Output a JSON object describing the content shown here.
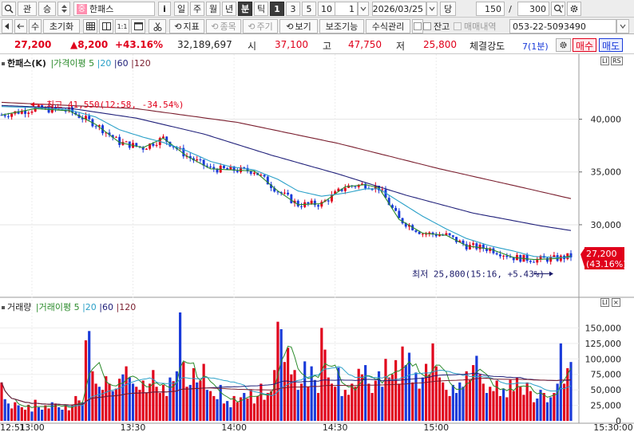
{
  "toolbar1": {
    "kwan": "관",
    "seung": "승",
    "stock_badge": "중",
    "stock_name": "한패스",
    "info_label": "i",
    "periods": [
      "일",
      "주",
      "월",
      "년",
      "분",
      "틱"
    ],
    "active_period": "분",
    "intervals": [
      "1",
      "3",
      "5",
      "10"
    ],
    "active_interval": "1",
    "interval_value": "1",
    "date": "2026/03/25",
    "dang": "당",
    "count_value": "150",
    "slash": "/",
    "total_value": "300"
  },
  "toolbar2": {
    "su": "수",
    "reset": "초기화",
    "indicator": "지표",
    "jongmok": "종목",
    "jugi": "주기",
    "view": "보기",
    "aux": "보조기능",
    "formula": "수식관리",
    "janggo": "잔고",
    "trade_history": "매매내역",
    "account": "053-22-5093490"
  },
  "info": {
    "price": "27,200",
    "change": "▲8,200",
    "change_pct": "+43.16%",
    "volume": "32,189,697",
    "open_label": "시",
    "open": "37,100",
    "high_label": "고",
    "high": "47,750",
    "low_label": "저",
    "low": "25,800",
    "strength_label": "체결강도",
    "strength_value": "7(1분)",
    "buy_label": "매수",
    "sell_label": "매도"
  },
  "legend_price": {
    "name": "한패스(K)",
    "ma_label": "가격이평",
    "periods": [
      "5",
      "20",
      "60",
      "120"
    ]
  },
  "legend_volume": {
    "name": "거래량",
    "ma_label": "거래이평",
    "periods": [
      "5",
      "20",
      "60",
      "120"
    ]
  },
  "annotations": {
    "high": "최고 41,550(12:58, -34.54%)",
    "low": "최저 25,800(15:16, +5.43%)"
  },
  "current_price_tag": {
    "price": "27,200",
    "pct": "(43.16%)"
  },
  "colors": {
    "up": "#e0001b",
    "down": "#1a3bd9",
    "ma5": "#2a8a2a",
    "ma20": "#2aa0c8",
    "ma60": "#20207a",
    "ma120": "#7a1e2e"
  },
  "chart_data": [
    {
      "type": "candlestick",
      "title": "한패스(K)",
      "x_ticks": [
        "12:51",
        "13:00",
        "13:30",
        "14:00",
        "14:30",
        "15:00",
        "15:30:00"
      ],
      "ylim": [
        23500,
        44800
      ],
      "y_ticks": [
        30000,
        35000,
        40000
      ],
      "y_tick_labels": [
        "30,000",
        "35,000",
        "40,000"
      ],
      "series": [
        {
          "name": "5",
          "kind": "ma5",
          "points": [
            [
              0,
              40400
            ],
            [
              10,
              41000
            ],
            [
              20,
              40800
            ],
            [
              28,
              39500
            ],
            [
              35,
              37800
            ],
            [
              42,
              37300
            ],
            [
              48,
              38200
            ],
            [
              55,
              36500
            ],
            [
              62,
              35300
            ],
            [
              68,
              35200
            ],
            [
              75,
              35100
            ],
            [
              82,
              33200
            ],
            [
              88,
              31900
            ],
            [
              95,
              32000
            ],
            [
              102,
              33600
            ],
            [
              108,
              33800
            ],
            [
              112,
              33500
            ],
            [
              118,
              30500
            ],
            [
              125,
              29200
            ],
            [
              132,
              29000
            ],
            [
              138,
              28000
            ],
            [
              145,
              27700
            ],
            [
              152,
              26900
            ],
            [
              158,
              26700
            ],
            [
              165,
              26800
            ],
            [
              170,
              27100
            ]
          ]
        },
        {
          "name": "20",
          "kind": "ma20",
          "points": [
            [
              0,
              41200
            ],
            [
              10,
              41100
            ],
            [
              20,
              40900
            ],
            [
              28,
              40200
            ],
            [
              35,
              39000
            ],
            [
              42,
              38300
            ],
            [
              48,
              37800
            ],
            [
              55,
              37000
            ],
            [
              62,
              36000
            ],
            [
              68,
              35500
            ],
            [
              75,
              35200
            ],
            [
              82,
              34300
            ],
            [
              88,
              33200
            ],
            [
              95,
              32700
            ],
            [
              102,
              33000
            ],
            [
              108,
              33400
            ],
            [
              112,
              33400
            ],
            [
              118,
              32200
            ],
            [
              125,
              30800
            ],
            [
              132,
              29600
            ],
            [
              138,
              28700
            ],
            [
              145,
              28000
            ],
            [
              152,
              27500
            ],
            [
              158,
              27000
            ],
            [
              165,
              26900
            ],
            [
              170,
              26900
            ]
          ]
        },
        {
          "name": "60",
          "kind": "ma60",
          "points": [
            [
              0,
              41300
            ],
            [
              20,
              41050
            ],
            [
              40,
              40100
            ],
            [
              60,
              38600
            ],
            [
              80,
              36600
            ],
            [
              100,
              34800
            ],
            [
              120,
              32800
            ],
            [
              140,
              31100
            ],
            [
              160,
              29900
            ],
            [
              170,
              29400
            ]
          ]
        },
        {
          "name": "120",
          "kind": "ma120",
          "points": [
            [
              0,
              41600
            ],
            [
              40,
              41000
            ],
            [
              70,
              39700
            ],
            [
              100,
              37700
            ],
            [
              130,
              35300
            ],
            [
              155,
              33500
            ],
            [
              170,
              32400
            ]
          ]
        }
      ],
      "high_marker": {
        "label": "최고 41,550(12:58, -34.54%)",
        "value": 41550
      },
      "low_marker": {
        "label": "최저 25,800(15:16, +5.43%)",
        "value": 25800
      },
      "last_price": 27200
    },
    {
      "type": "bar",
      "title": "거래량",
      "ylim": [
        0,
        175000
      ],
      "y_ticks": [
        0,
        25000,
        50000,
        75000,
        100000,
        125000,
        150000
      ],
      "y_tick_labels": [
        "0",
        "25,000",
        "50,000",
        "75,000",
        "100,000",
        "125,000",
        "150,000"
      ],
      "volumes": [
        62000,
        35000,
        28000,
        20000,
        30000,
        25000,
        22000,
        18000,
        26000,
        15000,
        34000,
        22000,
        18000,
        25000,
        20000,
        30000,
        28000,
        22000,
        18000,
        25000,
        17000,
        26000,
        40000,
        33000,
        30000,
        130000,
        145000,
        80000,
        60000,
        55000,
        50000,
        72000,
        60000,
        48000,
        52000,
        68000,
        75000,
        88000,
        70000,
        60000,
        55000,
        50000,
        65000,
        45000,
        60000,
        82000,
        55000,
        45000,
        58000,
        40000,
        70000,
        64000,
        80000,
        175000,
        95000,
        55000,
        58000,
        85000,
        62000,
        65000,
        92000,
        50000,
        48000,
        40000,
        35000,
        58000,
        28000,
        32000,
        22000,
        40000,
        30000,
        38000,
        45000,
        36000,
        50000,
        28000,
        40000,
        60000,
        34000,
        45000,
        48000,
        82000,
        160000,
        148000,
        95000,
        118000,
        75000,
        82000,
        50000,
        60000,
        96000,
        55000,
        88000,
        66000,
        45000,
        150000,
        115000,
        70000,
        60000,
        55000,
        86000,
        40000,
        50000,
        42000,
        60000,
        55000,
        84000,
        75000,
        90000,
        60000,
        45000,
        65000,
        80000,
        55000,
        100000,
        70000,
        75000,
        98000,
        60000,
        120000,
        90000,
        110000,
        62000,
        78000,
        52000,
        70000,
        92000,
        75000,
        125000,
        88000,
        70000,
        62000,
        50000,
        40000,
        58000,
        45000,
        62000,
        55000,
        80000,
        66000,
        90000,
        105000,
        75000,
        60000,
        45000,
        55000,
        48000,
        65000,
        40000,
        52000,
        38000,
        66000,
        48000,
        70000,
        55000,
        42000,
        62000,
        48000,
        30000,
        36000,
        50000,
        45000,
        30000,
        38000,
        45000,
        60000,
        125000,
        60000,
        85000,
        95000
      ],
      "series": [
        {
          "name": "5",
          "kind": "ma5"
        },
        {
          "name": "20",
          "kind": "ma20"
        },
        {
          "name": "60",
          "kind": "ma60"
        },
        {
          "name": "120",
          "kind": "ma120"
        }
      ]
    }
  ]
}
